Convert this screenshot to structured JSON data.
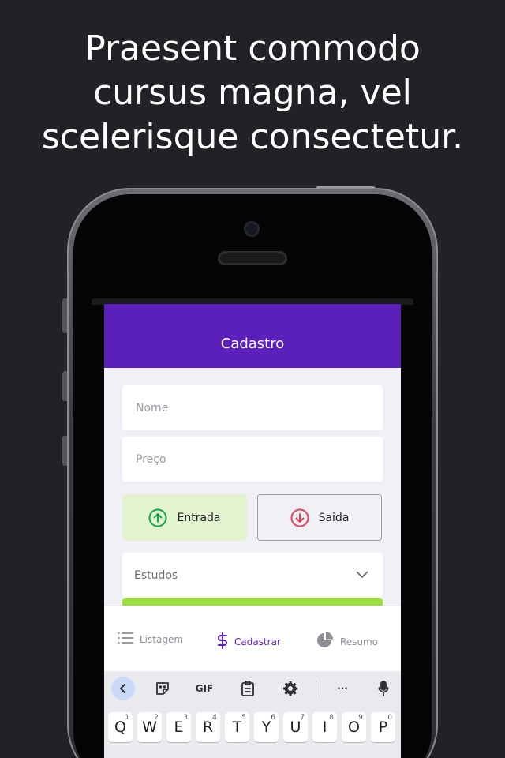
{
  "headline": "Praesent commodo\ncursus magna, vel\nscelerisque consectetur.",
  "appbar": {
    "title": "Cadastro"
  },
  "form": {
    "name_placeholder": "Nome",
    "price_placeholder": "Preço",
    "type_income_label": "Entrada",
    "type_outcome_label": "Saida",
    "category_value": "Estudos"
  },
  "colors": {
    "primary": "#5b1fbb",
    "income": "#12a454",
    "outcome": "#e83f5b",
    "income_bg": "#e3f2cf",
    "submit": "#9be03f"
  },
  "tabs": [
    {
      "label": "Listagem",
      "icon": "list-icon"
    },
    {
      "label": "Cadastrar",
      "icon": "dollar-icon"
    },
    {
      "label": "Resumo",
      "icon": "pie-chart-icon"
    }
  ],
  "keyboard": {
    "toolbar": [
      "back-icon",
      "sticker-icon",
      "GIF",
      "clipboard-icon",
      "gear-icon",
      "more-icon",
      "mic-icon"
    ],
    "gif_label": "GIF",
    "more_label": "···",
    "row1": [
      {
        "key": "Q",
        "hint": "1"
      },
      {
        "key": "W",
        "hint": "2"
      },
      {
        "key": "E",
        "hint": "3"
      },
      {
        "key": "R",
        "hint": "4"
      },
      {
        "key": "T",
        "hint": "5"
      },
      {
        "key": "Y",
        "hint": "6"
      },
      {
        "key": "U",
        "hint": "7"
      },
      {
        "key": "I",
        "hint": "8"
      },
      {
        "key": "O",
        "hint": "9"
      },
      {
        "key": "P",
        "hint": "0"
      }
    ]
  }
}
